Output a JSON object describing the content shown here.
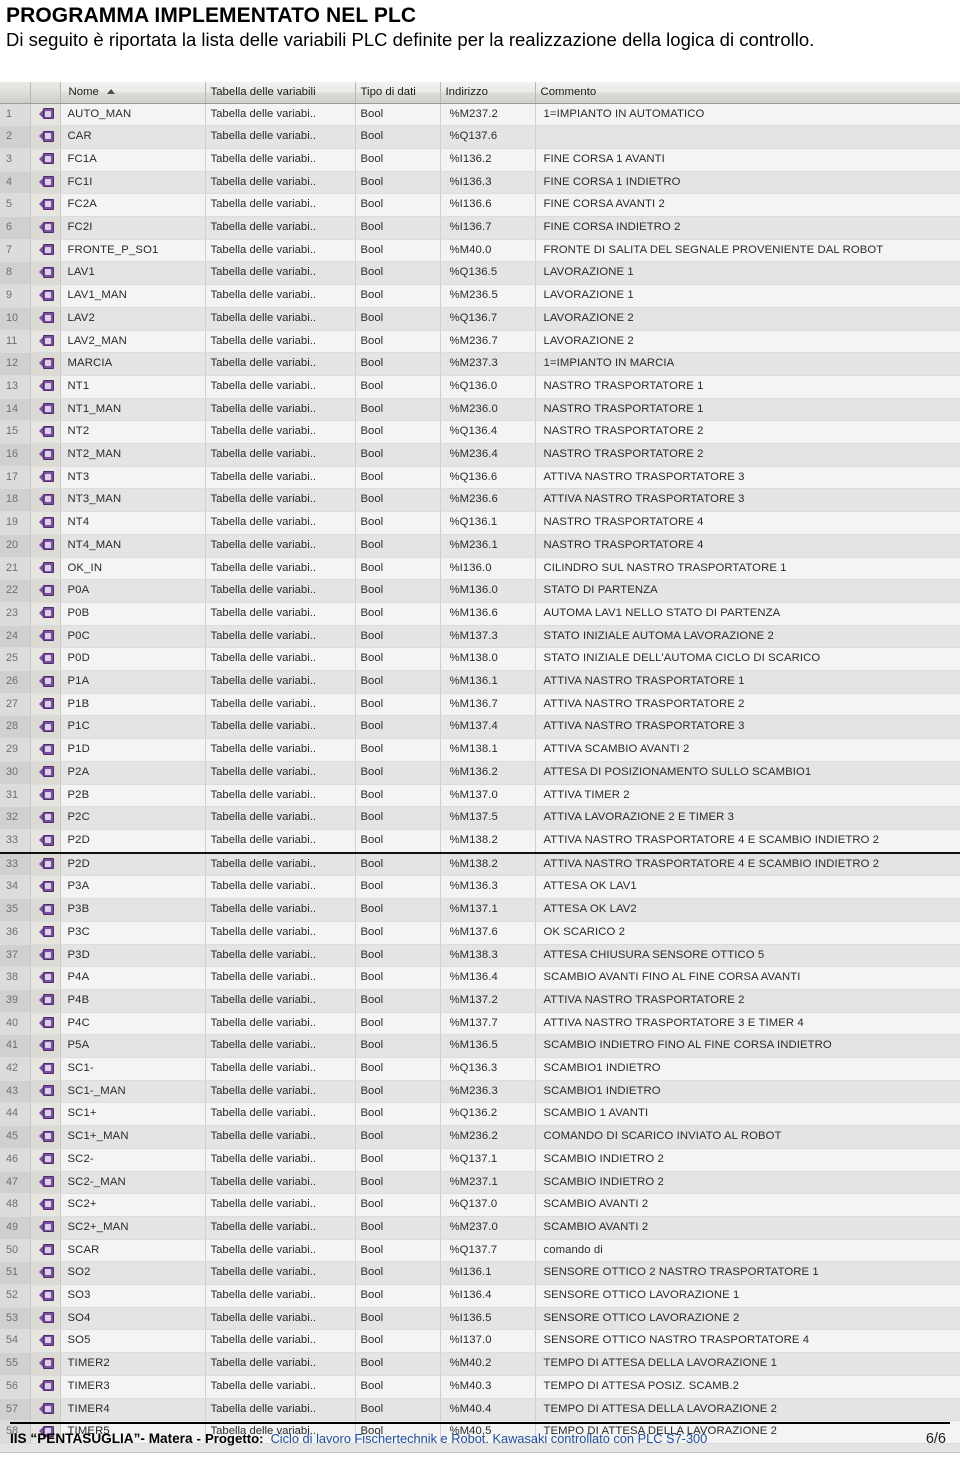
{
  "document": {
    "title": "PROGRAMMA IMPLEMENTATO NEL PLC",
    "intro": "Di seguito è riportata la lista delle variabili PLC definite per la realizzazione della logica di controllo."
  },
  "table": {
    "columns": {
      "number": "",
      "icon": "",
      "name": "Nome",
      "variable_table": "Tabella delle variabili",
      "data_type": "Tipo di dati",
      "address": "Indirizzo",
      "comment": "Commento"
    },
    "sort_column": "Nome",
    "sort_direction": "ascending",
    "rows": [
      {
        "n": "1",
        "name": "AUTO_MAN",
        "table": "Tabella delle variabi..",
        "type": "Bool",
        "addr": "%M237.2",
        "comment": "1=IMPIANTO IN AUTOMATICO"
      },
      {
        "n": "2",
        "name": "CAR",
        "table": "Tabella delle variabi..",
        "type": "Bool",
        "addr": "%Q137.6",
        "comment": ""
      },
      {
        "n": "3",
        "name": "FC1A",
        "table": "Tabella delle variabi..",
        "type": "Bool",
        "addr": "%I136.2",
        "comment": "FINE CORSA 1 AVANTI"
      },
      {
        "n": "4",
        "name": "FC1I",
        "table": "Tabella delle variabi..",
        "type": "Bool",
        "addr": "%I136.3",
        "comment": "FINE CORSA 1 INDIETRO"
      },
      {
        "n": "5",
        "name": "FC2A",
        "table": "Tabella delle variabi..",
        "type": "Bool",
        "addr": "%I136.6",
        "comment": "FINE CORSA AVANTI 2"
      },
      {
        "n": "6",
        "name": "FC2I",
        "table": "Tabella delle variabi..",
        "type": "Bool",
        "addr": "%I136.7",
        "comment": "FINE CORSA INDIETRO 2"
      },
      {
        "n": "7",
        "name": "FRONTE_P_SO1",
        "table": "Tabella delle variabi..",
        "type": "Bool",
        "addr": "%M40.0",
        "comment": "FRONTE DI SALITA DEL SEGNALE PROVENIENTE DAL ROBOT"
      },
      {
        "n": "8",
        "name": "LAV1",
        "table": "Tabella delle variabi..",
        "type": "Bool",
        "addr": "%Q136.5",
        "comment": "LAVORAZIONE 1"
      },
      {
        "n": "9",
        "name": "LAV1_MAN",
        "table": "Tabella delle variabi..",
        "type": "Bool",
        "addr": "%M236.5",
        "comment": "LAVORAZIONE 1"
      },
      {
        "n": "10",
        "name": "LAV2",
        "table": "Tabella delle variabi..",
        "type": "Bool",
        "addr": "%Q136.7",
        "comment": "LAVORAZIONE 2"
      },
      {
        "n": "11",
        "name": "LAV2_MAN",
        "table": "Tabella delle variabi..",
        "type": "Bool",
        "addr": "%M236.7",
        "comment": "LAVORAZIONE 2"
      },
      {
        "n": "12",
        "name": "MARCIA",
        "table": "Tabella delle variabi..",
        "type": "Bool",
        "addr": "%M237.3",
        "comment": "1=IMPIANTO IN MARCIA"
      },
      {
        "n": "13",
        "name": "NT1",
        "table": "Tabella delle variabi..",
        "type": "Bool",
        "addr": "%Q136.0",
        "comment": "NASTRO TRASPORTATORE 1"
      },
      {
        "n": "14",
        "name": "NT1_MAN",
        "table": "Tabella delle variabi..",
        "type": "Bool",
        "addr": "%M236.0",
        "comment": "NASTRO TRASPORTATORE 1"
      },
      {
        "n": "15",
        "name": "NT2",
        "table": "Tabella delle variabi..",
        "type": "Bool",
        "addr": "%Q136.4",
        "comment": "NASTRO TRASPORTATORE 2"
      },
      {
        "n": "16",
        "name": "NT2_MAN",
        "table": "Tabella delle variabi..",
        "type": "Bool",
        "addr": "%M236.4",
        "comment": "NASTRO TRASPORTATORE 2"
      },
      {
        "n": "17",
        "name": "NT3",
        "table": "Tabella delle variabi..",
        "type": "Bool",
        "addr": "%Q136.6",
        "comment": "ATTIVA NASTRO TRASPORTATORE 3"
      },
      {
        "n": "18",
        "name": "NT3_MAN",
        "table": "Tabella delle variabi..",
        "type": "Bool",
        "addr": "%M236.6",
        "comment": "ATTIVA NASTRO TRASPORTATORE 3"
      },
      {
        "n": "19",
        "name": "NT4",
        "table": "Tabella delle variabi..",
        "type": "Bool",
        "addr": "%Q136.1",
        "comment": "NASTRO TRASPORTATORE 4"
      },
      {
        "n": "20",
        "name": "NT4_MAN",
        "table": "Tabella delle variabi..",
        "type": "Bool",
        "addr": "%M236.1",
        "comment": "NASTRO TRASPORTATORE 4"
      },
      {
        "n": "21",
        "name": "OK_IN",
        "table": "Tabella delle variabi..",
        "type": "Bool",
        "addr": "%I136.0",
        "comment": "CILINDRO SUL NASTRO TRASPORTATORE 1"
      },
      {
        "n": "22",
        "name": "P0A",
        "table": "Tabella delle variabi..",
        "type": "Bool",
        "addr": "%M136.0",
        "comment": "STATO DI PARTENZA"
      },
      {
        "n": "23",
        "name": "P0B",
        "table": "Tabella delle variabi..",
        "type": "Bool",
        "addr": "%M136.6",
        "comment": "AUTOMA LAV1 NELLO STATO DI PARTENZA"
      },
      {
        "n": "24",
        "name": "P0C",
        "table": "Tabella delle variabi..",
        "type": "Bool",
        "addr": "%M137.3",
        "comment": "STATO INIZIALE AUTOMA LAVORAZIONE 2"
      },
      {
        "n": "25",
        "name": "P0D",
        "table": "Tabella delle variabi..",
        "type": "Bool",
        "addr": "%M138.0",
        "comment": "STATO INIZIALE DELL'AUTOMA CICLO DI SCARICO"
      },
      {
        "n": "26",
        "name": "P1A",
        "table": "Tabella delle variabi..",
        "type": "Bool",
        "addr": "%M136.1",
        "comment": "ATTIVA NASTRO TRASPORTATORE 1"
      },
      {
        "n": "27",
        "name": "P1B",
        "table": "Tabella delle variabi..",
        "type": "Bool",
        "addr": "%M136.7",
        "comment": "ATTIVA NASTRO TRASPORTATORE 2"
      },
      {
        "n": "28",
        "name": "P1C",
        "table": "Tabella delle variabi..",
        "type": "Bool",
        "addr": "%M137.4",
        "comment": "ATTIVA NASTRO TRASPORTATORE 3"
      },
      {
        "n": "29",
        "name": "P1D",
        "table": "Tabella delle variabi..",
        "type": "Bool",
        "addr": "%M138.1",
        "comment": "ATTIVA SCAMBIO AVANTI 2"
      },
      {
        "n": "30",
        "name": "P2A",
        "table": "Tabella delle variabi..",
        "type": "Bool",
        "addr": "%M136.2",
        "comment": "ATTESA DI POSIZIONAMENTO SULLO SCAMBIO1"
      },
      {
        "n": "31",
        "name": "P2B",
        "table": "Tabella delle variabi..",
        "type": "Bool",
        "addr": "%M137.0",
        "comment": "ATTIVA TIMER 2"
      },
      {
        "n": "32",
        "name": "P2C",
        "table": "Tabella delle variabi..",
        "type": "Bool",
        "addr": "%M137.5",
        "comment": "ATTIVA LAVORAZIONE 2 E TIMER 3"
      },
      {
        "n": "33",
        "name": "P2D",
        "table": "Tabella delle variabi..",
        "type": "Bool",
        "addr": "%M138.2",
        "comment": "ATTIVA NASTRO TRASPORTATORE 4 E SCAMBIO INDIETRO 2"
      },
      {
        "n": "33",
        "name": "P2D",
        "table": "Tabella delle variabi..",
        "type": "Bool",
        "addr": "%M138.2",
        "comment": "ATTIVA NASTRO TRASPORTATORE 4 E SCAMBIO INDIETRO 2",
        "breakline": true
      },
      {
        "n": "34",
        "name": "P3A",
        "table": "Tabella delle variabi..",
        "type": "Bool",
        "addr": "%M136.3",
        "comment": "ATTESA OK LAV1"
      },
      {
        "n": "35",
        "name": "P3B",
        "table": "Tabella delle variabi..",
        "type": "Bool",
        "addr": "%M137.1",
        "comment": "ATTESA OK LAV2"
      },
      {
        "n": "36",
        "name": "P3C",
        "table": "Tabella delle variabi..",
        "type": "Bool",
        "addr": "%M137.6",
        "comment": "OK SCARICO 2"
      },
      {
        "n": "37",
        "name": "P3D",
        "table": "Tabella delle variabi..",
        "type": "Bool",
        "addr": "%M138.3",
        "comment": "ATTESA CHIUSURA SENSORE OTTICO 5"
      },
      {
        "n": "38",
        "name": "P4A",
        "table": "Tabella delle variabi..",
        "type": "Bool",
        "addr": "%M136.4",
        "comment": "SCAMBIO AVANTI FINO AL FINE CORSA AVANTI"
      },
      {
        "n": "39",
        "name": "P4B",
        "table": "Tabella delle variabi..",
        "type": "Bool",
        "addr": "%M137.2",
        "comment": "ATTIVA NASTRO TRASPORTATORE 2"
      },
      {
        "n": "40",
        "name": "P4C",
        "table": "Tabella delle variabi..",
        "type": "Bool",
        "addr": "%M137.7",
        "comment": "ATTIVA NASTRO TRASPORTATORE 3 E TIMER 4"
      },
      {
        "n": "41",
        "name": "P5A",
        "table": "Tabella delle variabi..",
        "type": "Bool",
        "addr": "%M136.5",
        "comment": "SCAMBIO INDIETRO FINO AL FINE CORSA INDIETRO"
      },
      {
        "n": "42",
        "name": "SC1-",
        "table": "Tabella delle variabi..",
        "type": "Bool",
        "addr": "%Q136.3",
        "comment": "SCAMBIO1 INDIETRO"
      },
      {
        "n": "43",
        "name": "SC1-_MAN",
        "table": "Tabella delle variabi..",
        "type": "Bool",
        "addr": "%M236.3",
        "comment": "SCAMBIO1 INDIETRO"
      },
      {
        "n": "44",
        "name": "SC1+",
        "table": "Tabella delle variabi..",
        "type": "Bool",
        "addr": "%Q136.2",
        "comment": "SCAMBIO 1 AVANTI"
      },
      {
        "n": "45",
        "name": "SC1+_MAN",
        "table": "Tabella delle variabi..",
        "type": "Bool",
        "addr": "%M236.2",
        "comment": "COMANDO DI SCARICO INVIATO AL ROBOT"
      },
      {
        "n": "46",
        "name": "SC2-",
        "table": "Tabella delle variabi..",
        "type": "Bool",
        "addr": "%Q137.1",
        "comment": "SCAMBIO INDIETRO 2"
      },
      {
        "n": "47",
        "name": "SC2-_MAN",
        "table": "Tabella delle variabi..",
        "type": "Bool",
        "addr": "%M237.1",
        "comment": "SCAMBIO INDIETRO 2"
      },
      {
        "n": "48",
        "name": "SC2+",
        "table": "Tabella delle variabi..",
        "type": "Bool",
        "addr": "%Q137.0",
        "comment": "SCAMBIO AVANTI 2"
      },
      {
        "n": "49",
        "name": "SC2+_MAN",
        "table": "Tabella delle variabi..",
        "type": "Bool",
        "addr": "%M237.0",
        "comment": "SCAMBIO AVANTI 2"
      },
      {
        "n": "50",
        "name": "SCAR",
        "table": "Tabella delle variabi..",
        "type": "Bool",
        "addr": "%Q137.7",
        "comment": "comando di"
      },
      {
        "n": "51",
        "name": "SO2",
        "table": "Tabella delle variabi..",
        "type": "Bool",
        "addr": "%I136.1",
        "comment": "SENSORE OTTICO 2 NASTRO TRASPORTATORE 1"
      },
      {
        "n": "52",
        "name": "SO3",
        "table": "Tabella delle variabi..",
        "type": "Bool",
        "addr": "%I136.4",
        "comment": "SENSORE OTTICO LAVORAZIONE 1"
      },
      {
        "n": "53",
        "name": "SO4",
        "table": "Tabella delle variabi..",
        "type": "Bool",
        "addr": "%I136.5",
        "comment": "SENSORE OTTICO LAVORAZIONE 2"
      },
      {
        "n": "54",
        "name": "SO5",
        "table": "Tabella delle variabi..",
        "type": "Bool",
        "addr": "%I137.0",
        "comment": "SENSORE OTTICO NASTRO TRASPORTATORE 4"
      },
      {
        "n": "55",
        "name": "TIMER2",
        "table": "Tabella delle variabi..",
        "type": "Bool",
        "addr": "%M40.2",
        "comment": "TEMPO DI ATTESA DELLA LAVORAZIONE 1"
      },
      {
        "n": "56",
        "name": "TIMER3",
        "table": "Tabella delle variabi..",
        "type": "Bool",
        "addr": "%M40.3",
        "comment": "TEMPO DI ATTESA POSIZ. SCAMB.2"
      },
      {
        "n": "57",
        "name": "TIMER4",
        "table": "Tabella delle variabi..",
        "type": "Bool",
        "addr": "%M40.4",
        "comment": "TEMPO DI ATTESA DELLA LAVORAZIONE 2"
      },
      {
        "n": "58",
        "name": "TIMER5",
        "table": "Tabella delle variabi..",
        "type": "Bool",
        "addr": "%M40.5",
        "comment": "TEMPO DI ATTESA DELLA LAVORAZIONE 2"
      }
    ]
  },
  "footer": {
    "school": "IIS “PENTASUGLIA”- Matera",
    "separator": "-",
    "project_label": "Progetto:",
    "project_value": "Ciclo di lavoro Fischertechnik e Robot. Kawasaki controllato con PLC S7-300",
    "page": "6/6"
  },
  "colors": {
    "tag_icon": "#7b4f9e",
    "project_text": "#1f4e9c",
    "row_odd": "#f4f4f4",
    "row_even": "#e4e4e4"
  }
}
